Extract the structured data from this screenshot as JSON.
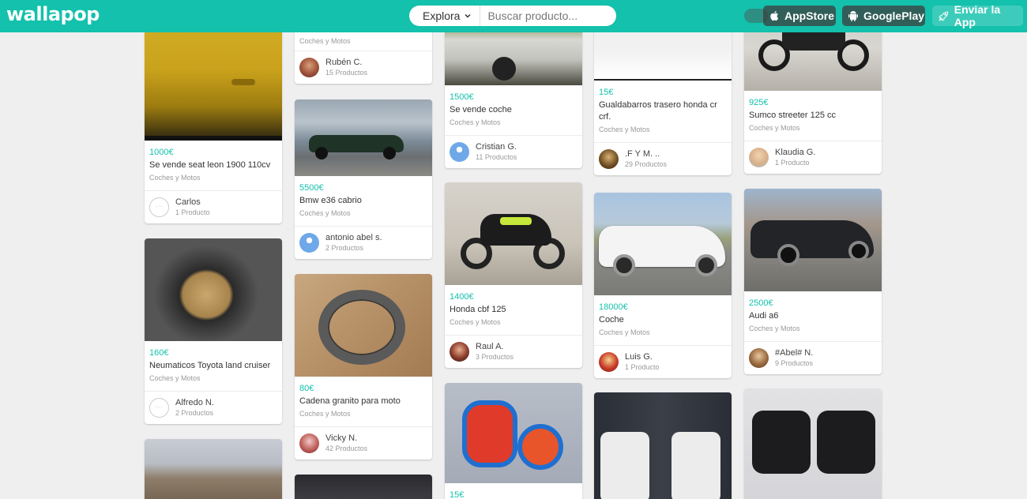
{
  "header": {
    "logo": "wallapop",
    "explore_label": "Explora",
    "search_placeholder": "Buscar producto...",
    "appstore_label": "AppStore",
    "googleplay_label": "GooglePlay",
    "send_app_label": "Enviar la App",
    "brand_color": "#13c1ac"
  },
  "listings": [
    {
      "price": "1000€",
      "title": "Se vende seat leon 1900 110cv",
      "category": "Coches y Motos",
      "user": "Carlos",
      "count": "1 Producto"
    },
    {
      "price": "160€",
      "title": "Neumaticos Toyota land cruiser",
      "category": "Coches y Motos",
      "user": "Alfredo N.",
      "count": "2 Productos"
    },
    {
      "category": "Coches y Motos",
      "user": "Rubén C.",
      "count": "15 Productos"
    },
    {
      "price": "5500€",
      "title": "Bmw e36 cabrio",
      "category": "Coches y Motos",
      "user": "antonio abel s.",
      "count": "2 Productos"
    },
    {
      "price": "80€",
      "title": "Cadena granito para moto",
      "category": "Coches y Motos",
      "user": "Vicky N.",
      "count": "42 Productos"
    },
    {
      "price": "1500€",
      "title": "Se vende coche",
      "category": "Coches y Motos",
      "user": "Cristian G.",
      "count": "11 Productos"
    },
    {
      "price": "1400€",
      "title": "Honda cbf 125",
      "category": "Coches y Motos",
      "user": "Raul A.",
      "count": "3 Productos"
    },
    {
      "price": "15€"
    },
    {
      "price": "15€",
      "title": "Gualdabarros trasero honda cr crf.",
      "category": "Coches y Motos",
      "user": ".F Y M. ..",
      "count": "29 Productos"
    },
    {
      "price": "18000€",
      "title": "Coche",
      "category": "Coches y Motos",
      "user": "Luis G.",
      "count": "1 Producto"
    },
    {
      "price": "925€",
      "title": "Sumco streeter 125 cc",
      "category": "Coches y Motos",
      "user": "Klaudia G.",
      "count": "1 Producto"
    },
    {
      "price": "2500€",
      "title": "Audi a6",
      "category": "Coches y Motos",
      "user": "#Abel# N.",
      "count": "9 Productos"
    }
  ]
}
